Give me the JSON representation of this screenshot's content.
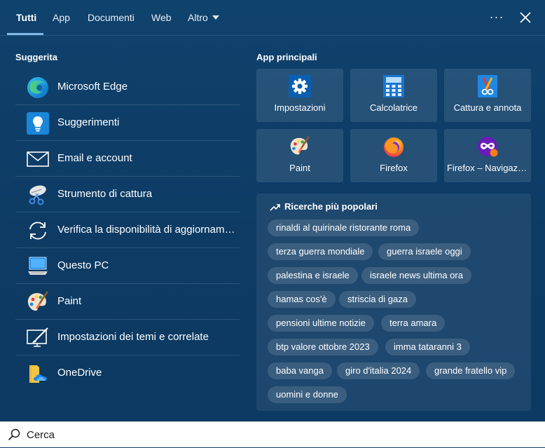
{
  "tabs": [
    {
      "label": "Tutti"
    },
    {
      "label": "App"
    },
    {
      "label": "Documenti"
    },
    {
      "label": "Web"
    },
    {
      "label": "Altro"
    }
  ],
  "more_label": "···",
  "suggested": {
    "title": "Suggerita",
    "items": [
      {
        "label": "Microsoft Edge",
        "icon": "edge-icon"
      },
      {
        "label": "Suggerimenti",
        "icon": "tips-icon"
      },
      {
        "label": "Email e account",
        "icon": "mail-icon"
      },
      {
        "label": "Strumento di cattura",
        "icon": "snipping-tool-icon"
      },
      {
        "label": "Verifica la disponibilità di aggiornamenti",
        "icon": "refresh-icon"
      },
      {
        "label": "Questo PC",
        "icon": "computer-icon"
      },
      {
        "label": "Paint",
        "icon": "paint-palette-icon"
      },
      {
        "label": "Impostazioni dei temi e correlate",
        "icon": "theme-settings-icon"
      },
      {
        "label": "OneDrive",
        "icon": "onedrive-icon"
      }
    ]
  },
  "top_apps": {
    "title": "App principali",
    "items": [
      {
        "label": "Impostazioni",
        "icon": "gear-icon"
      },
      {
        "label": "Calcolatrice",
        "icon": "calculator-icon"
      },
      {
        "label": "Cattura e annota",
        "icon": "snip-sketch-icon"
      },
      {
        "label": "Paint",
        "icon": "paint-palette-icon"
      },
      {
        "label": "Firefox",
        "icon": "firefox-icon"
      },
      {
        "label": "Firefox – Navigazione anonima",
        "icon": "firefox-private-icon"
      }
    ]
  },
  "popular": {
    "title": "Ricerche più popolari",
    "searches": [
      "rinaldi al quirinale ristorante roma",
      "terza guerra mondiale",
      "guerra israele oggi",
      "palestina e israele",
      "israele news ultima ora",
      "hamas cos'è",
      "striscia di gaza",
      "pensioni ultime notizie",
      "terra amara",
      "btp valore ottobre 2023",
      "imma tataranni 3",
      "baba vanga",
      "giro d'italia 2024",
      "grande fratello vip",
      "uomini e donne"
    ]
  },
  "search": {
    "text": "Cerca"
  },
  "colors": {
    "panel": "#0f426d",
    "accent": "#7fb7e6",
    "searchbar": "#ffffff"
  }
}
